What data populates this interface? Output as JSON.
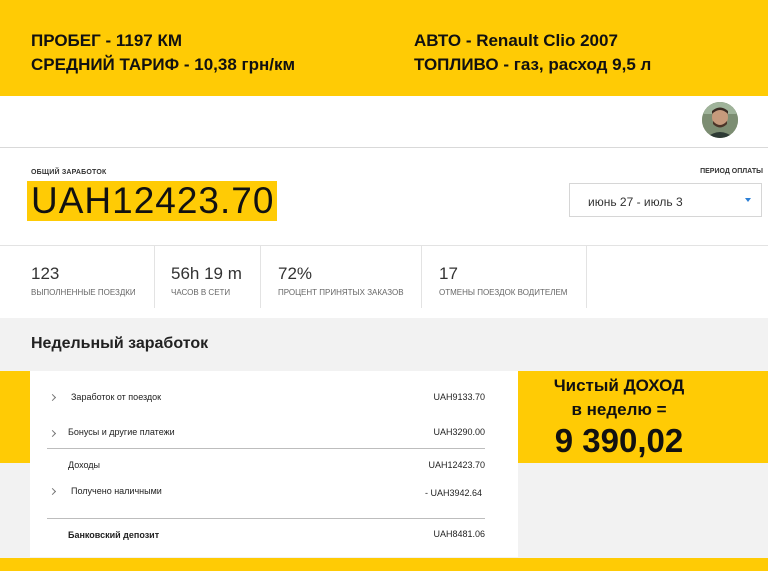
{
  "banner": {
    "mileage": "ПРОБЕГ - 1197 КМ",
    "avg_tariff": "СРЕДНИЙ ТАРИФ - 10,38 грн/км",
    "car": "АВТО - Renault Clio 2007",
    "fuel": "ТОПЛИВО - газ, расход 9,5 л"
  },
  "earnings": {
    "label": "ОБЩИЙ ЗАРАБОТОК",
    "amount": "UAH12423.70"
  },
  "period": {
    "label": "ПЕРИОД ОПЛАТЫ",
    "selected": "июнь 27 - июль 3"
  },
  "stats": [
    {
      "value": "123",
      "label": "ВЫПОЛНЕННЫЕ ПОЕЗДКИ"
    },
    {
      "value": "56h 19 m",
      "label": "ЧАСОВ В СЕТИ"
    },
    {
      "value": "72%",
      "label": "ПРОЦЕНТ ПРИНЯТЫХ ЗАКАЗОВ"
    },
    {
      "value": "17",
      "label": "ОТМЕНЫ ПОЕЗДОК ВОДИТЕЛЕМ"
    }
  ],
  "weekly": {
    "title": "Недельный заработок",
    "rows": [
      {
        "label": "Заработок от поездок",
        "value": "UAH9133.70"
      },
      {
        "label": "Бонусы и другие платежи",
        "value": "UAH3290.00"
      },
      {
        "label": "Доходы",
        "value": "UAH12423.70"
      },
      {
        "label": "Получено наличными",
        "value": "- UAH3942.64"
      },
      {
        "label": "Банковский депозит",
        "value": "UAH8481.06"
      }
    ]
  },
  "net_income": {
    "line1": "Чистый ДОХОД",
    "line2": "в неделю =",
    "value": "9 390,02"
  },
  "colors": {
    "accent_yellow": "#ffcb05",
    "dropdown_caret": "#2b7fd6",
    "background_gray": "#f2f2f2"
  },
  "icons": {
    "avatar": "user-avatar-photo",
    "caret": "caret-down-icon",
    "row_chevron": "chevron-right-icon"
  }
}
